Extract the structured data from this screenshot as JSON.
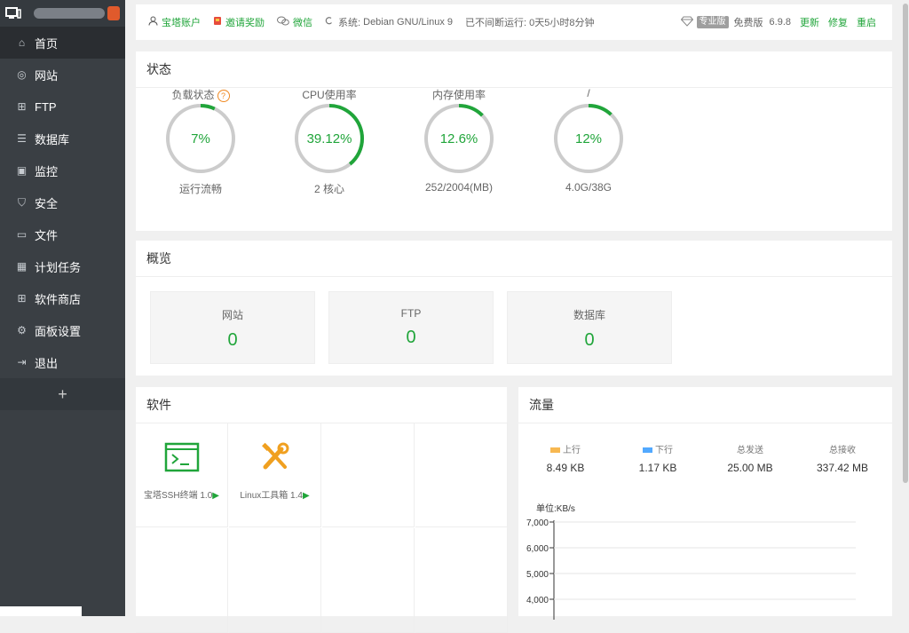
{
  "sidebar": {
    "items": [
      {
        "label": "首页",
        "icon": "home-icon",
        "active": true
      },
      {
        "label": "网站",
        "icon": "globe-icon"
      },
      {
        "label": "FTP",
        "icon": "ftp-icon"
      },
      {
        "label": "数据库",
        "icon": "database-icon"
      },
      {
        "label": "监控",
        "icon": "monitor-icon"
      },
      {
        "label": "安全",
        "icon": "shield-icon"
      },
      {
        "label": "文件",
        "icon": "folder-icon"
      },
      {
        "label": "计划任务",
        "icon": "calendar-icon"
      },
      {
        "label": "软件商店",
        "icon": "grid-icon"
      },
      {
        "label": "面板设置",
        "icon": "gear-icon"
      },
      {
        "label": "退出",
        "icon": "logout-icon"
      }
    ],
    "add_label": "+"
  },
  "topbar": {
    "account": "宝塔账户",
    "invite": "邀请奖励",
    "wechat": "微信",
    "system_label": "系统:",
    "system_value": "Debian GNU/Linux 9",
    "uptime": "已不间断运行: 0天5小时8分钟",
    "pro_badge": "专业版",
    "edition": "免费版",
    "version": "6.9.8",
    "update": "更新",
    "repair": "修复",
    "restart": "重启"
  },
  "status": {
    "title": "状态",
    "gauges": [
      {
        "label": "负载状态",
        "value": "7%",
        "percent": 7,
        "sub": "运行流畅",
        "help": "?"
      },
      {
        "label": "CPU使用率",
        "value": "39.12%",
        "percent": 39.12,
        "sub": "2 核心"
      },
      {
        "label": "内存使用率",
        "value": "12.6%",
        "percent": 12.6,
        "sub": "252/2004(MB)"
      },
      {
        "label": "/",
        "value": "12%",
        "percent": 12,
        "sub": "4.0G/38G"
      }
    ]
  },
  "overview": {
    "title": "概览",
    "boxes": [
      {
        "label": "网站",
        "value": "0"
      },
      {
        "label": "FTP",
        "value": "0"
      },
      {
        "label": "数据库",
        "value": "0"
      }
    ]
  },
  "software": {
    "title": "软件",
    "items": [
      {
        "name": "宝塔SSH终端 1.0",
        "icon": "terminal-icon"
      },
      {
        "name": "Linux工具箱 1.4",
        "icon": "tools-icon"
      }
    ]
  },
  "traffic": {
    "title": "流量",
    "stats": [
      {
        "label": "上行",
        "value": "8.49 KB",
        "color": "#f7b851"
      },
      {
        "label": "下行",
        "value": "1.17 KB",
        "color": "#52a9ff"
      },
      {
        "label": "总发送",
        "value": "25.00 MB"
      },
      {
        "label": "总接收",
        "value": "337.42 MB"
      }
    ],
    "unit": "单位:KB/s",
    "chart_data": {
      "type": "line",
      "yticks": [
        "7,000",
        "6,000",
        "5,000",
        "4,000"
      ],
      "ylabel": "单位:KB/s",
      "series": []
    }
  },
  "colors": {
    "accent": "#20a53a",
    "sidebar": "#3a3f44",
    "gauge_track": "#cccccc"
  }
}
